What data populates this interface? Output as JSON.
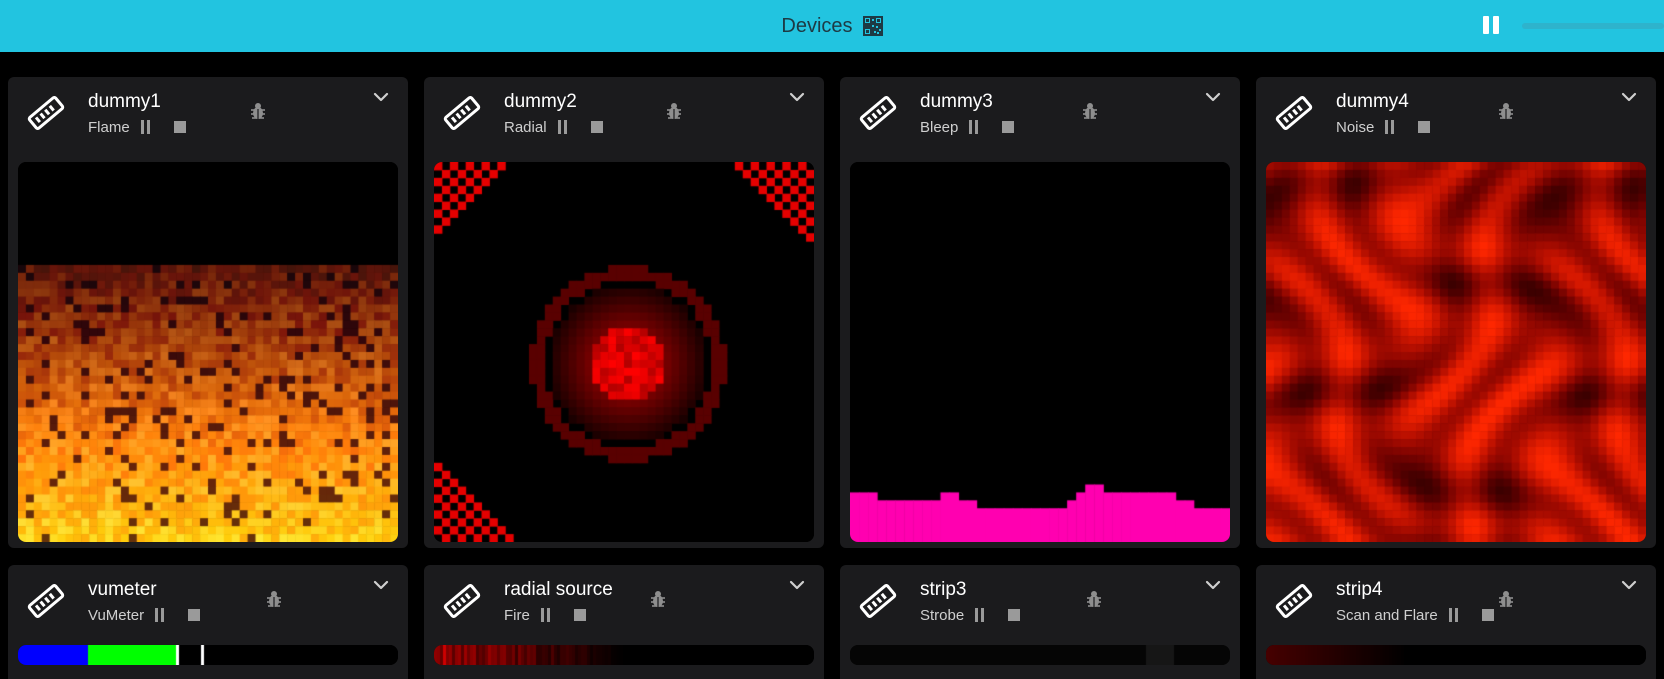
{
  "header": {
    "title": "Devices"
  },
  "colors": {
    "topbar": "#22c4e0",
    "card": "#1b1b1d",
    "bleep": "#ff00b0",
    "vu_blue": "#0000ff",
    "vu_green": "#00ff00"
  },
  "devices": [
    {
      "name": "dummy1",
      "effect": "Flame"
    },
    {
      "name": "dummy2",
      "effect": "Radial"
    },
    {
      "name": "dummy3",
      "effect": "Bleep"
    },
    {
      "name": "dummy4",
      "effect": "Noise"
    },
    {
      "name": "vumeter",
      "effect": "VuMeter"
    },
    {
      "name": "radial source",
      "effect": "Fire"
    },
    {
      "name": "strip3",
      "effect": "Strobe"
    },
    {
      "name": "strip4",
      "effect": "Scan and Flare"
    }
  ]
}
